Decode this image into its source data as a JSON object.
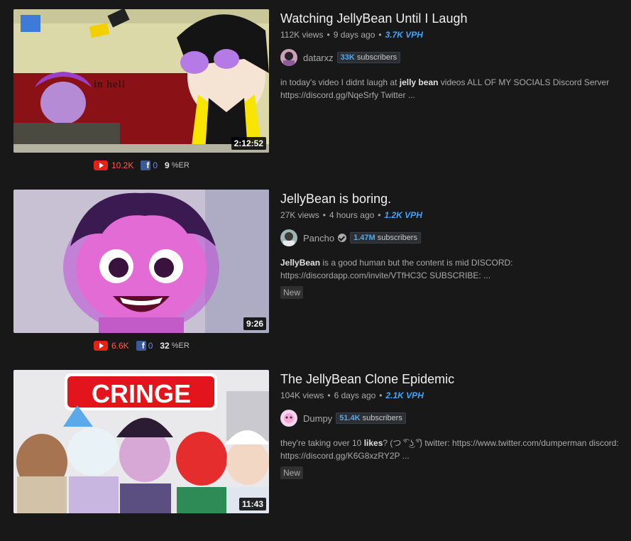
{
  "videos": [
    {
      "title": "Watching JellyBean Until I Laugh",
      "views": "112K views",
      "age": "9 days ago",
      "vph": "3.7K VPH",
      "channel": "datarxz",
      "verified": false,
      "subs_count": "33K",
      "subs_label": "subscribers",
      "desc_pre": "in today's video I didnt laugh at ",
      "desc_bold": "jelly bean",
      "desc_post": " videos ALL OF MY SOCIALS Discord Server https://discord.gg/NqeSrfy Twitter ...",
      "badge": "",
      "duration": "2:12:52",
      "yt_count": "10.2K",
      "fb_count": "0",
      "er_value": "9",
      "er_unit": "%ER",
      "thumb_text": "in hell"
    },
    {
      "title": "JellyBean is boring.",
      "views": "27K views",
      "age": "4 hours ago",
      "vph": "1.2K VPH",
      "channel": "Pancho",
      "verified": true,
      "subs_count": "1.47M",
      "subs_label": "subscribers",
      "desc_pre": "",
      "desc_bold": "JellyBean",
      "desc_post": " is a good human but the content is mid DISCORD: https://discordapp.com/invite/VTfHC3C SUBSCRIBE: ...",
      "badge": "New",
      "duration": "9:26",
      "yt_count": "6.6K",
      "fb_count": "0",
      "er_value": "32",
      "er_unit": "%ER"
    },
    {
      "title": "The JellyBean Clone Epidemic",
      "views": "104K views",
      "age": "6 days ago",
      "vph": "2.1K VPH",
      "channel": "Dumpy",
      "verified": false,
      "subs_count": "51.4K",
      "subs_label": "subscribers",
      "desc_pre": "they're taking over 10 ",
      "desc_bold": "likes",
      "desc_post": "? (つ ͡° ͜ʖ ͡°) twitter: https://www.twitter.com/dumperman discord: https://discord.gg/K6G8xzRY2P ...",
      "badge": "New",
      "duration": "11:43",
      "thumb_text": "CRINGE"
    }
  ],
  "icons": {
    "youtube": "youtube-icon",
    "facebook": "facebook-icon",
    "verified": "verified-check-icon"
  },
  "colors": {
    "background": "#181818",
    "vph": "#3ea6ff",
    "youtube_red": "#e62117",
    "facebook_blue": "#3b5998"
  }
}
